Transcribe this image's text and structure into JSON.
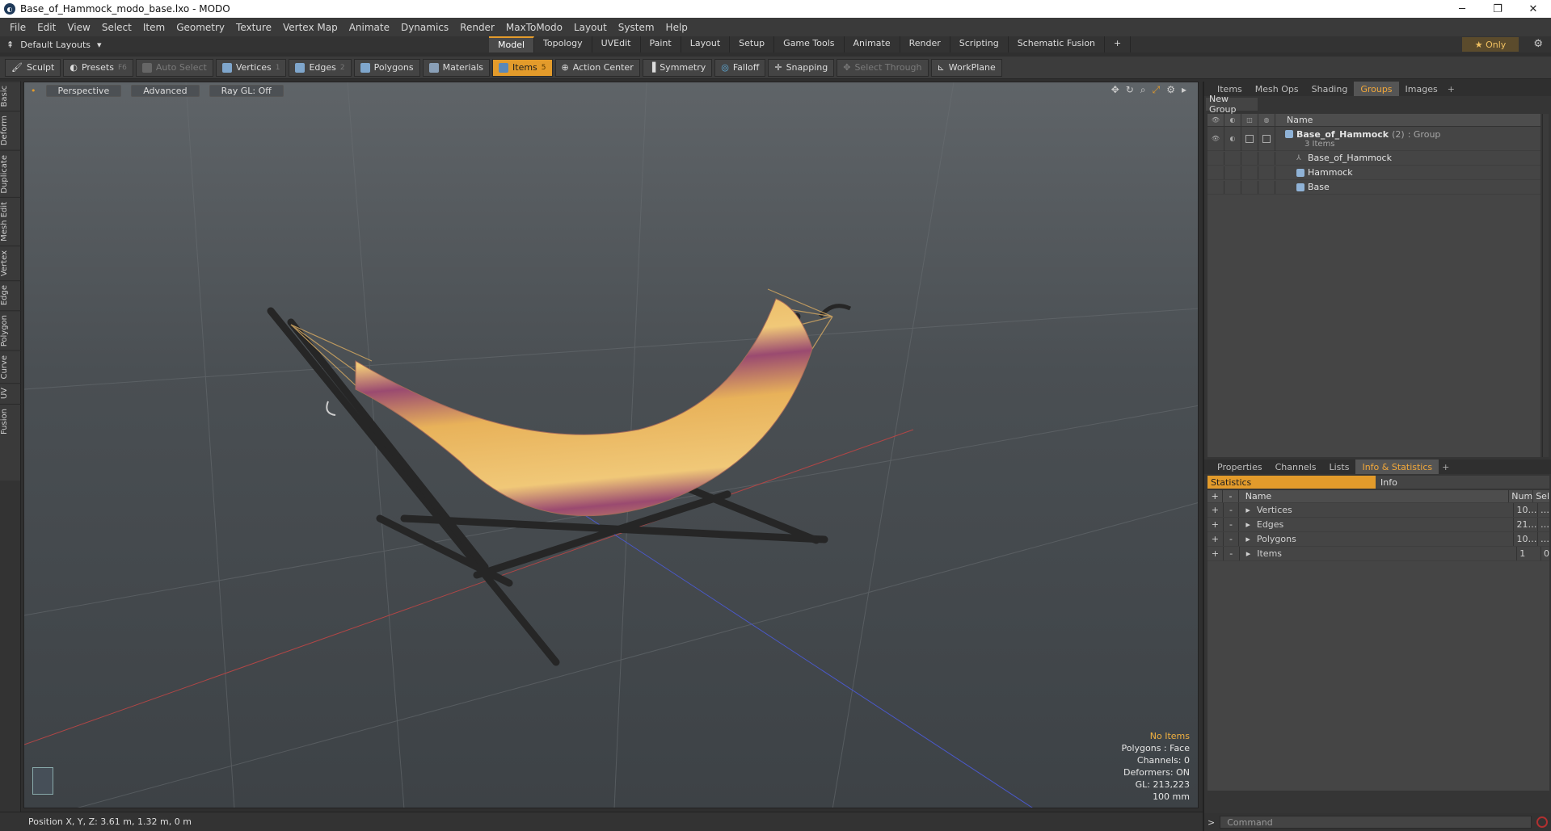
{
  "window": {
    "title": "Base_of_Hammock_modo_base.lxo - MODO",
    "minimize": "─",
    "maximize": "❐",
    "close": "✕"
  },
  "menu": [
    "File",
    "Edit",
    "View",
    "Select",
    "Item",
    "Geometry",
    "Texture",
    "Vertex Map",
    "Animate",
    "Dynamics",
    "Render",
    "MaxToModo",
    "Layout",
    "System",
    "Help"
  ],
  "layout": {
    "label": "Default Layouts"
  },
  "mode_tabs": [
    "Model",
    "Topology",
    "UVEdit",
    "Paint",
    "Layout",
    "Setup",
    "Game Tools",
    "Animate",
    "Render",
    "Scripting",
    "Schematic Fusion"
  ],
  "mode_active": "Model",
  "only_label": "Only",
  "toolbar": {
    "sculpt": "Sculpt",
    "presets": "Presets",
    "presets_key": "F6",
    "auto_select": "Auto Select",
    "vertices": "Vertices",
    "vertices_key": "1",
    "edges": "Edges",
    "edges_key": "2",
    "polygons": "Polygons",
    "materials": "Materials",
    "items": "Items",
    "items_key": "5",
    "action_center": "Action Center",
    "symmetry": "Symmetry",
    "falloff": "Falloff",
    "snapping": "Snapping",
    "select_through": "Select Through",
    "workplane": "WorkPlane"
  },
  "left_tabs": [
    "Basic",
    "Deform",
    "Duplicate",
    "Mesh Edit",
    "Vertex",
    "Edge",
    "Polygon",
    "Curve",
    "UV",
    "Fusion"
  ],
  "viewport": {
    "perspective": "Perspective",
    "advanced": "Advanced",
    "raygl": "Ray GL: Off",
    "stats": {
      "no_items": "No Items",
      "polygons": "Polygons : Face",
      "channels": "Channels: 0",
      "deformers": "Deformers: ON",
      "gl": "GL: 213,223",
      "scale": "100 mm"
    }
  },
  "status": {
    "position": "Position X, Y, Z:  3.61 m, 1.32 m, 0 m"
  },
  "upper_tabs": [
    "Items",
    "Mesh Ops",
    "Shading",
    "Groups",
    "Images"
  ],
  "upper_active": "Groups",
  "groups": {
    "new_group": "New Group",
    "name_header": "Name",
    "root": {
      "name": "Base_of_Hammock",
      "count": "(2)",
      "type": ": Group",
      "sub": "3 Items"
    },
    "children": [
      "Base_of_Hammock",
      "Hammock",
      "Base"
    ]
  },
  "lower_tabs": [
    "Properties",
    "Channels",
    "Lists",
    "Info & Statistics"
  ],
  "lower_active": "Info & Statistics",
  "stats": {
    "statistics_tab": "Statistics",
    "info_tab": "Info",
    "headers": {
      "name": "Name",
      "num": "Num",
      "sel": "Sel"
    },
    "rows": [
      {
        "name": "Vertices",
        "num": "10…",
        "sel": "…"
      },
      {
        "name": "Edges",
        "num": "21…",
        "sel": "…"
      },
      {
        "name": "Polygons",
        "num": "10…",
        "sel": "…"
      },
      {
        "name": "Items",
        "num": "1",
        "sel": "0"
      }
    ]
  },
  "command": {
    "placeholder": "Command"
  },
  "colors": {
    "accent": "#e39b2b",
    "hammock_a": "#e8b25a",
    "hammock_b": "#9a4a70",
    "frame": "#2a2a2a"
  }
}
